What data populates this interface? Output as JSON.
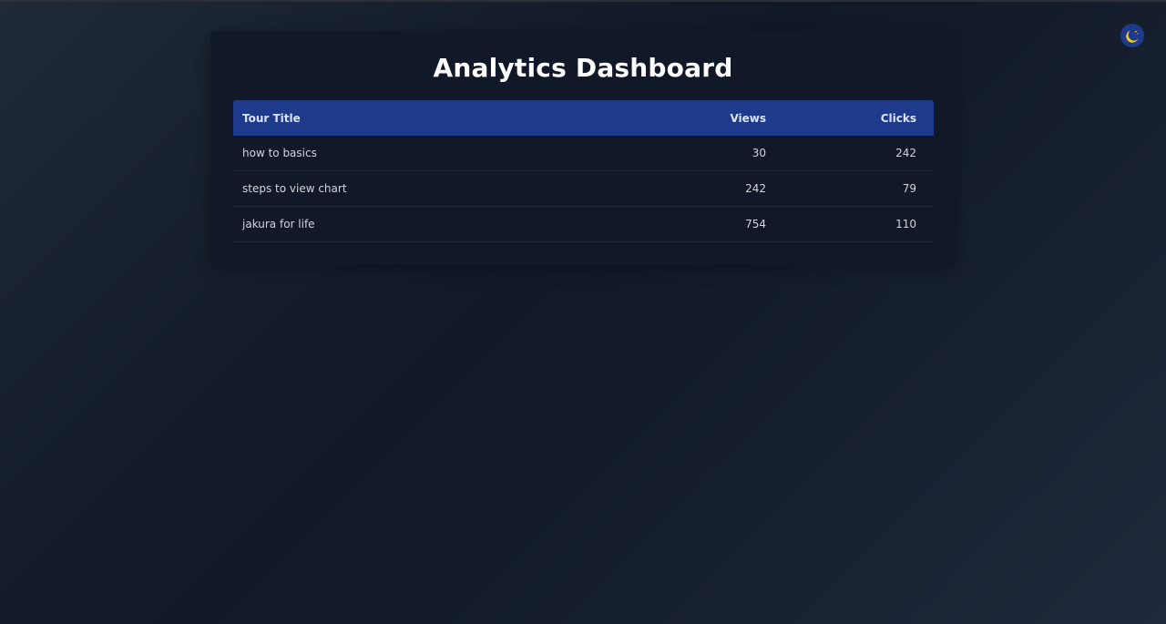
{
  "page": {
    "title": "Analytics Dashboard"
  },
  "theme_toggle": {
    "icon": "moon-icon",
    "accent": "#1e3a8a",
    "moon_color": "#facc15"
  },
  "table": {
    "headers": [
      "Tour Title",
      "Views",
      "Clicks"
    ],
    "rows": [
      {
        "title": "how to basics",
        "views": "30",
        "clicks": "242"
      },
      {
        "title": "steps to view chart",
        "views": "242",
        "clicks": "79"
      },
      {
        "title": "jakura for life",
        "views": "754",
        "clicks": "110"
      }
    ]
  },
  "colors": {
    "header_bg": "#1e3a8a",
    "card_bg": "#111827",
    "text": "#d1d5db"
  }
}
